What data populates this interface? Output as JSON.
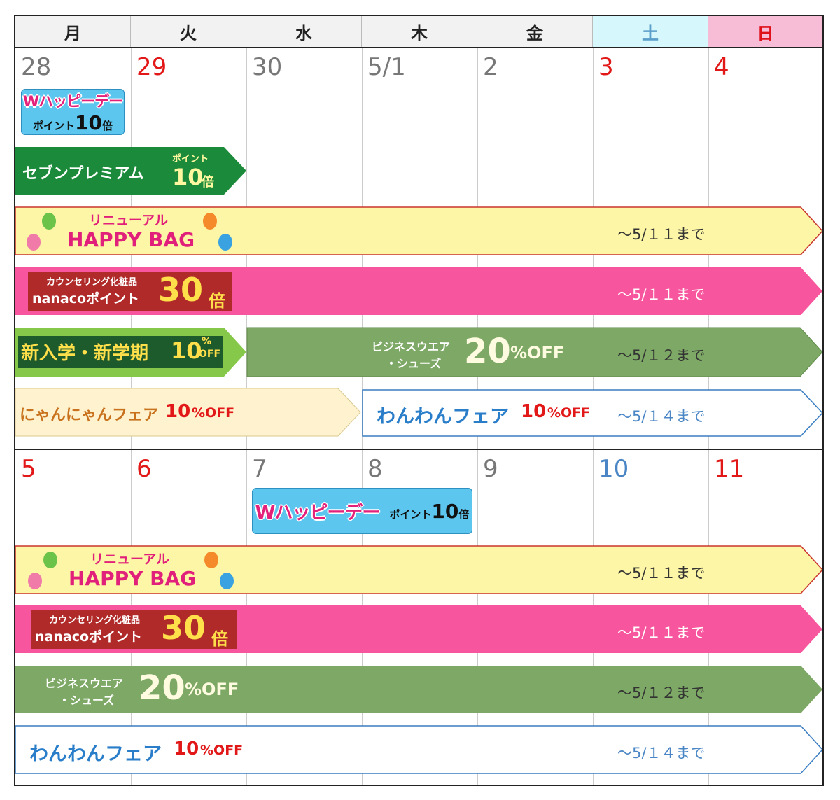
{
  "weekdays": [
    "月",
    "火",
    "水",
    "木",
    "金",
    "土",
    "日"
  ],
  "week1": {
    "days": [
      "28",
      "29",
      "30",
      "5/1",
      "2",
      "3",
      "4"
    ]
  },
  "week2": {
    "days": [
      "5",
      "6",
      "7",
      "8",
      "9",
      "10",
      "11"
    ]
  },
  "w_happy_day": {
    "logo": "Wハッピーデー",
    "points_label": "ポイント",
    "points_value": "10",
    "points_unit": "倍"
  },
  "seven_premium": {
    "name": "セブンプレミアム",
    "points_label": "ポイント",
    "points_value": "10",
    "points_unit": "倍"
  },
  "happy_bag": {
    "line1": "リニューアル",
    "line2": "HAPPY BAG",
    "until": "～5/１１まで"
  },
  "counseling": {
    "line1": "カウンセリング化粧品",
    "line2": "nanacoポイント",
    "value": "30",
    "unit": "倍",
    "until": "～5/１１まで"
  },
  "new_school": {
    "text": "新入学・新学期",
    "value": "10",
    "pct": "%",
    "off": "OFF"
  },
  "business": {
    "line1": "ビジネスウエア",
    "line2": "・シューズ",
    "value": "20",
    "off": "%OFF",
    "until": "～5/１２まで"
  },
  "nyan": {
    "text": "にゃんにゃんフェア",
    "value": "10",
    "off": "%OFF"
  },
  "wan": {
    "text": "わんわんフェア",
    "value": "10",
    "off": "%OFF",
    "until": "～5/１４まで"
  },
  "colors": {
    "happy_bag_fill": "#fdf6a6",
    "happy_bag_stroke": "#c9352e",
    "counseling_fill": "#f7559e",
    "counseling_label_bg": "#b12a2a",
    "seven_green": "#1b8a3a",
    "new_school_green": "#86c94a",
    "business_green": "#7da865",
    "nyan_fill": "#fff3cf",
    "wan_stroke": "#3a7dc1",
    "badge_blue": "#5cc6ee"
  }
}
